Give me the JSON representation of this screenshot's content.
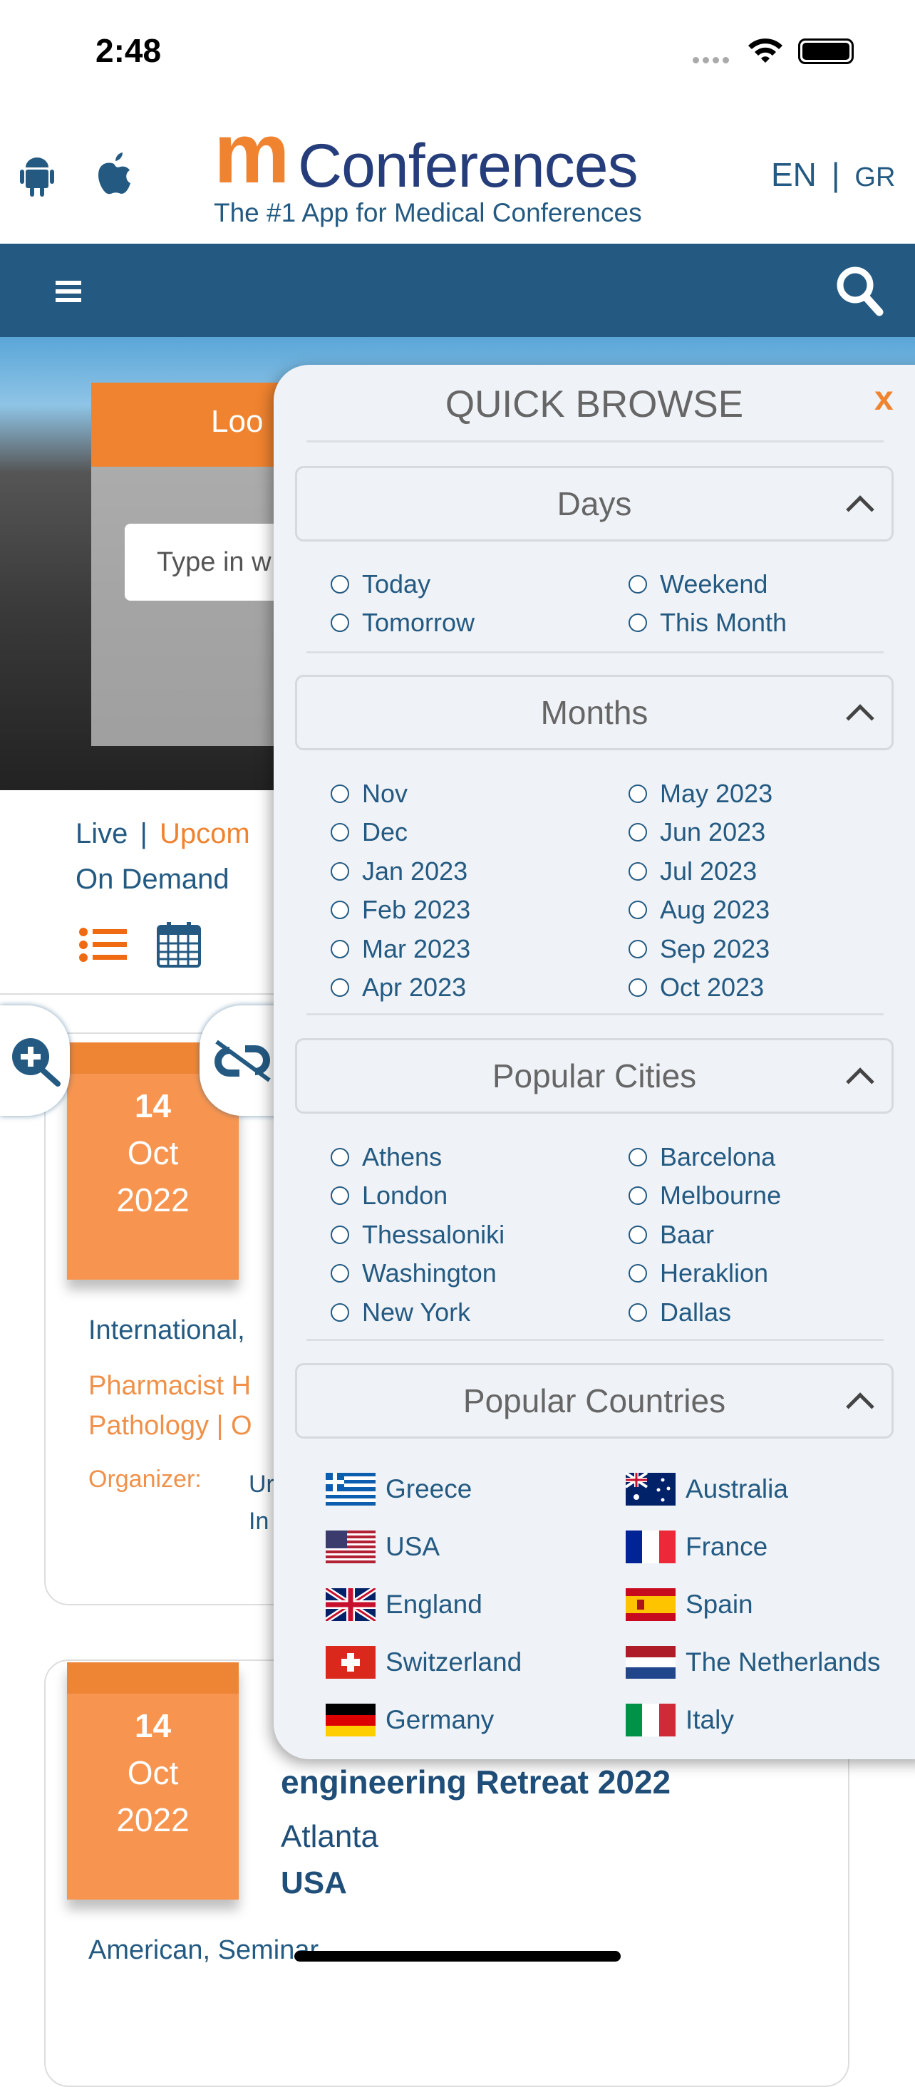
{
  "status": {
    "time": "2:48"
  },
  "header": {
    "logo_text": "mConferences",
    "tagline": "The #1 App for Medical Conferences",
    "lang_en": "EN",
    "lang_sep": "|",
    "lang_gr": "GR",
    "icons": [
      "android-icon",
      "apple-icon"
    ]
  },
  "nav": {
    "icons": [
      "hamburger-menu-icon",
      "search-icon"
    ]
  },
  "hero": {
    "heading_partial": "Loo",
    "input_placeholder": "Type in w"
  },
  "tabs": {
    "live": "Live",
    "sep": "|",
    "upcoming": "Upcom",
    "on_demand": "On Demand"
  },
  "cards": [
    {
      "day": "14",
      "month": "Oct",
      "year": "2022",
      "type": "International,",
      "specialties_line1": "Pharmacist H",
      "specialties_line2": "Pathology | O",
      "organizer_label": "Organizer:",
      "organizer_line1": "Ur",
      "organizer_line2": "In"
    },
    {
      "day": "14",
      "month": "Oct",
      "year": "2022",
      "title": "engineering Retreat 2022",
      "city": "Atlanta",
      "country": "USA",
      "type": "American, Seminar"
    }
  ],
  "quick_browse": {
    "title": "QUICK BROWSE",
    "close": "x",
    "days": {
      "label": "Days",
      "options": [
        "Today",
        "Weekend",
        "Tomorrow",
        "This Month"
      ]
    },
    "months": {
      "label": "Months",
      "options": [
        "Nov",
        "May 2023",
        "Dec",
        "Jun 2023",
        "Jan 2023",
        "Jul 2023",
        "Feb 2023",
        "Aug 2023",
        "Mar 2023",
        "Sep 2023",
        "Apr 2023",
        "Oct 2023"
      ]
    },
    "cities": {
      "label": "Popular Cities",
      "options": [
        "Athens",
        "Barcelona",
        "London",
        "Melbourne",
        "Thessaloniki",
        "Baar",
        "Washington",
        "Heraklion",
        "New York",
        "Dallas"
      ]
    },
    "countries": {
      "label": "Popular Countries",
      "options": [
        "Greece",
        "Australia",
        "USA",
        "France",
        "England",
        "Spain",
        "Switzerland",
        "The Netherlands",
        "Germany",
        "Italy"
      ]
    }
  },
  "colors": {
    "brand_blue": "#245a82",
    "accent_orange": "#f0832f",
    "date_orange": "#f79550",
    "panel_bg": "#eff3f7"
  }
}
